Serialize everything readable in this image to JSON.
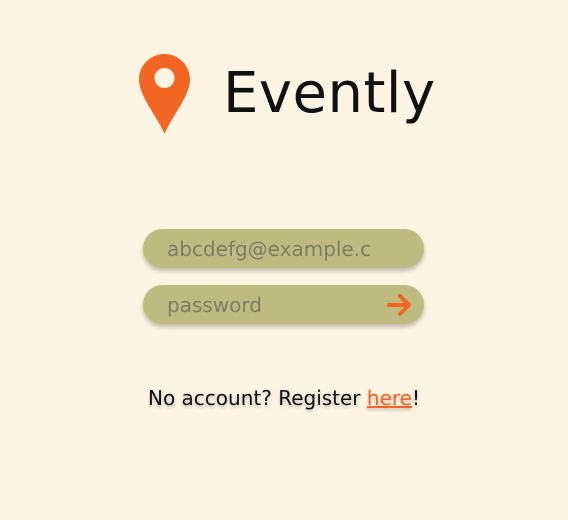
{
  "app": {
    "title": "Evently",
    "logo_icon": "map-pin-icon"
  },
  "login": {
    "email_placeholder": "abcdefg@example.com",
    "password_placeholder": "password",
    "submit_icon": "arrow-right-icon"
  },
  "register": {
    "prompt": "No account? Register ",
    "link_label": "here",
    "suffix": "!"
  },
  "colors": {
    "background": "#fdf5e4",
    "accent": "#f26522",
    "field_background": "#bdbb7f",
    "text": "#111111"
  }
}
